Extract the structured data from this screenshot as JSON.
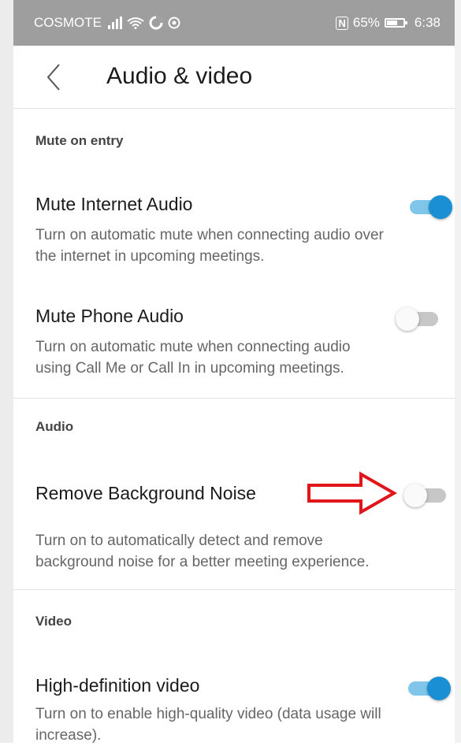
{
  "status_bar": {
    "carrier": "COSMOTE",
    "nfc": "N",
    "battery_percent": "65%",
    "time": "6:38"
  },
  "header": {
    "title": "Audio & video",
    "back_icon": "chevron-left-icon"
  },
  "sections": {
    "mute_on_entry": {
      "label": "Mute on entry",
      "items": [
        {
          "title": "Mute Internet Audio",
          "description_line1": "Turn on automatic mute when connecting audio over",
          "description_line2": "the internet in upcoming meetings.",
          "enabled": true
        },
        {
          "title": "Mute Phone Audio",
          "description_line1": "Turn on automatic mute when connecting audio",
          "description_line2": "using Call Me or Call In in upcoming meetings.",
          "enabled": false
        }
      ]
    },
    "audio": {
      "label": "Audio",
      "items": [
        {
          "title": "Remove Background Noise",
          "description_line1": "Turn on to automatically detect and remove",
          "description_line2": "background noise for a better meeting experience.",
          "enabled": false
        }
      ]
    },
    "video": {
      "label": "Video",
      "items": [
        {
          "title": "High-definition video",
          "description_line1": "Turn on to enable high-quality video (data usage will",
          "description_line2": "increase).",
          "enabled": true
        }
      ]
    }
  },
  "colors": {
    "toggle_on": "#1a8fd4",
    "toggle_on_track": "#7fc6ea",
    "toggle_off_track": "#c7c7c7",
    "annotation": "#e0161b",
    "status_bar": "#9e9e9e"
  }
}
